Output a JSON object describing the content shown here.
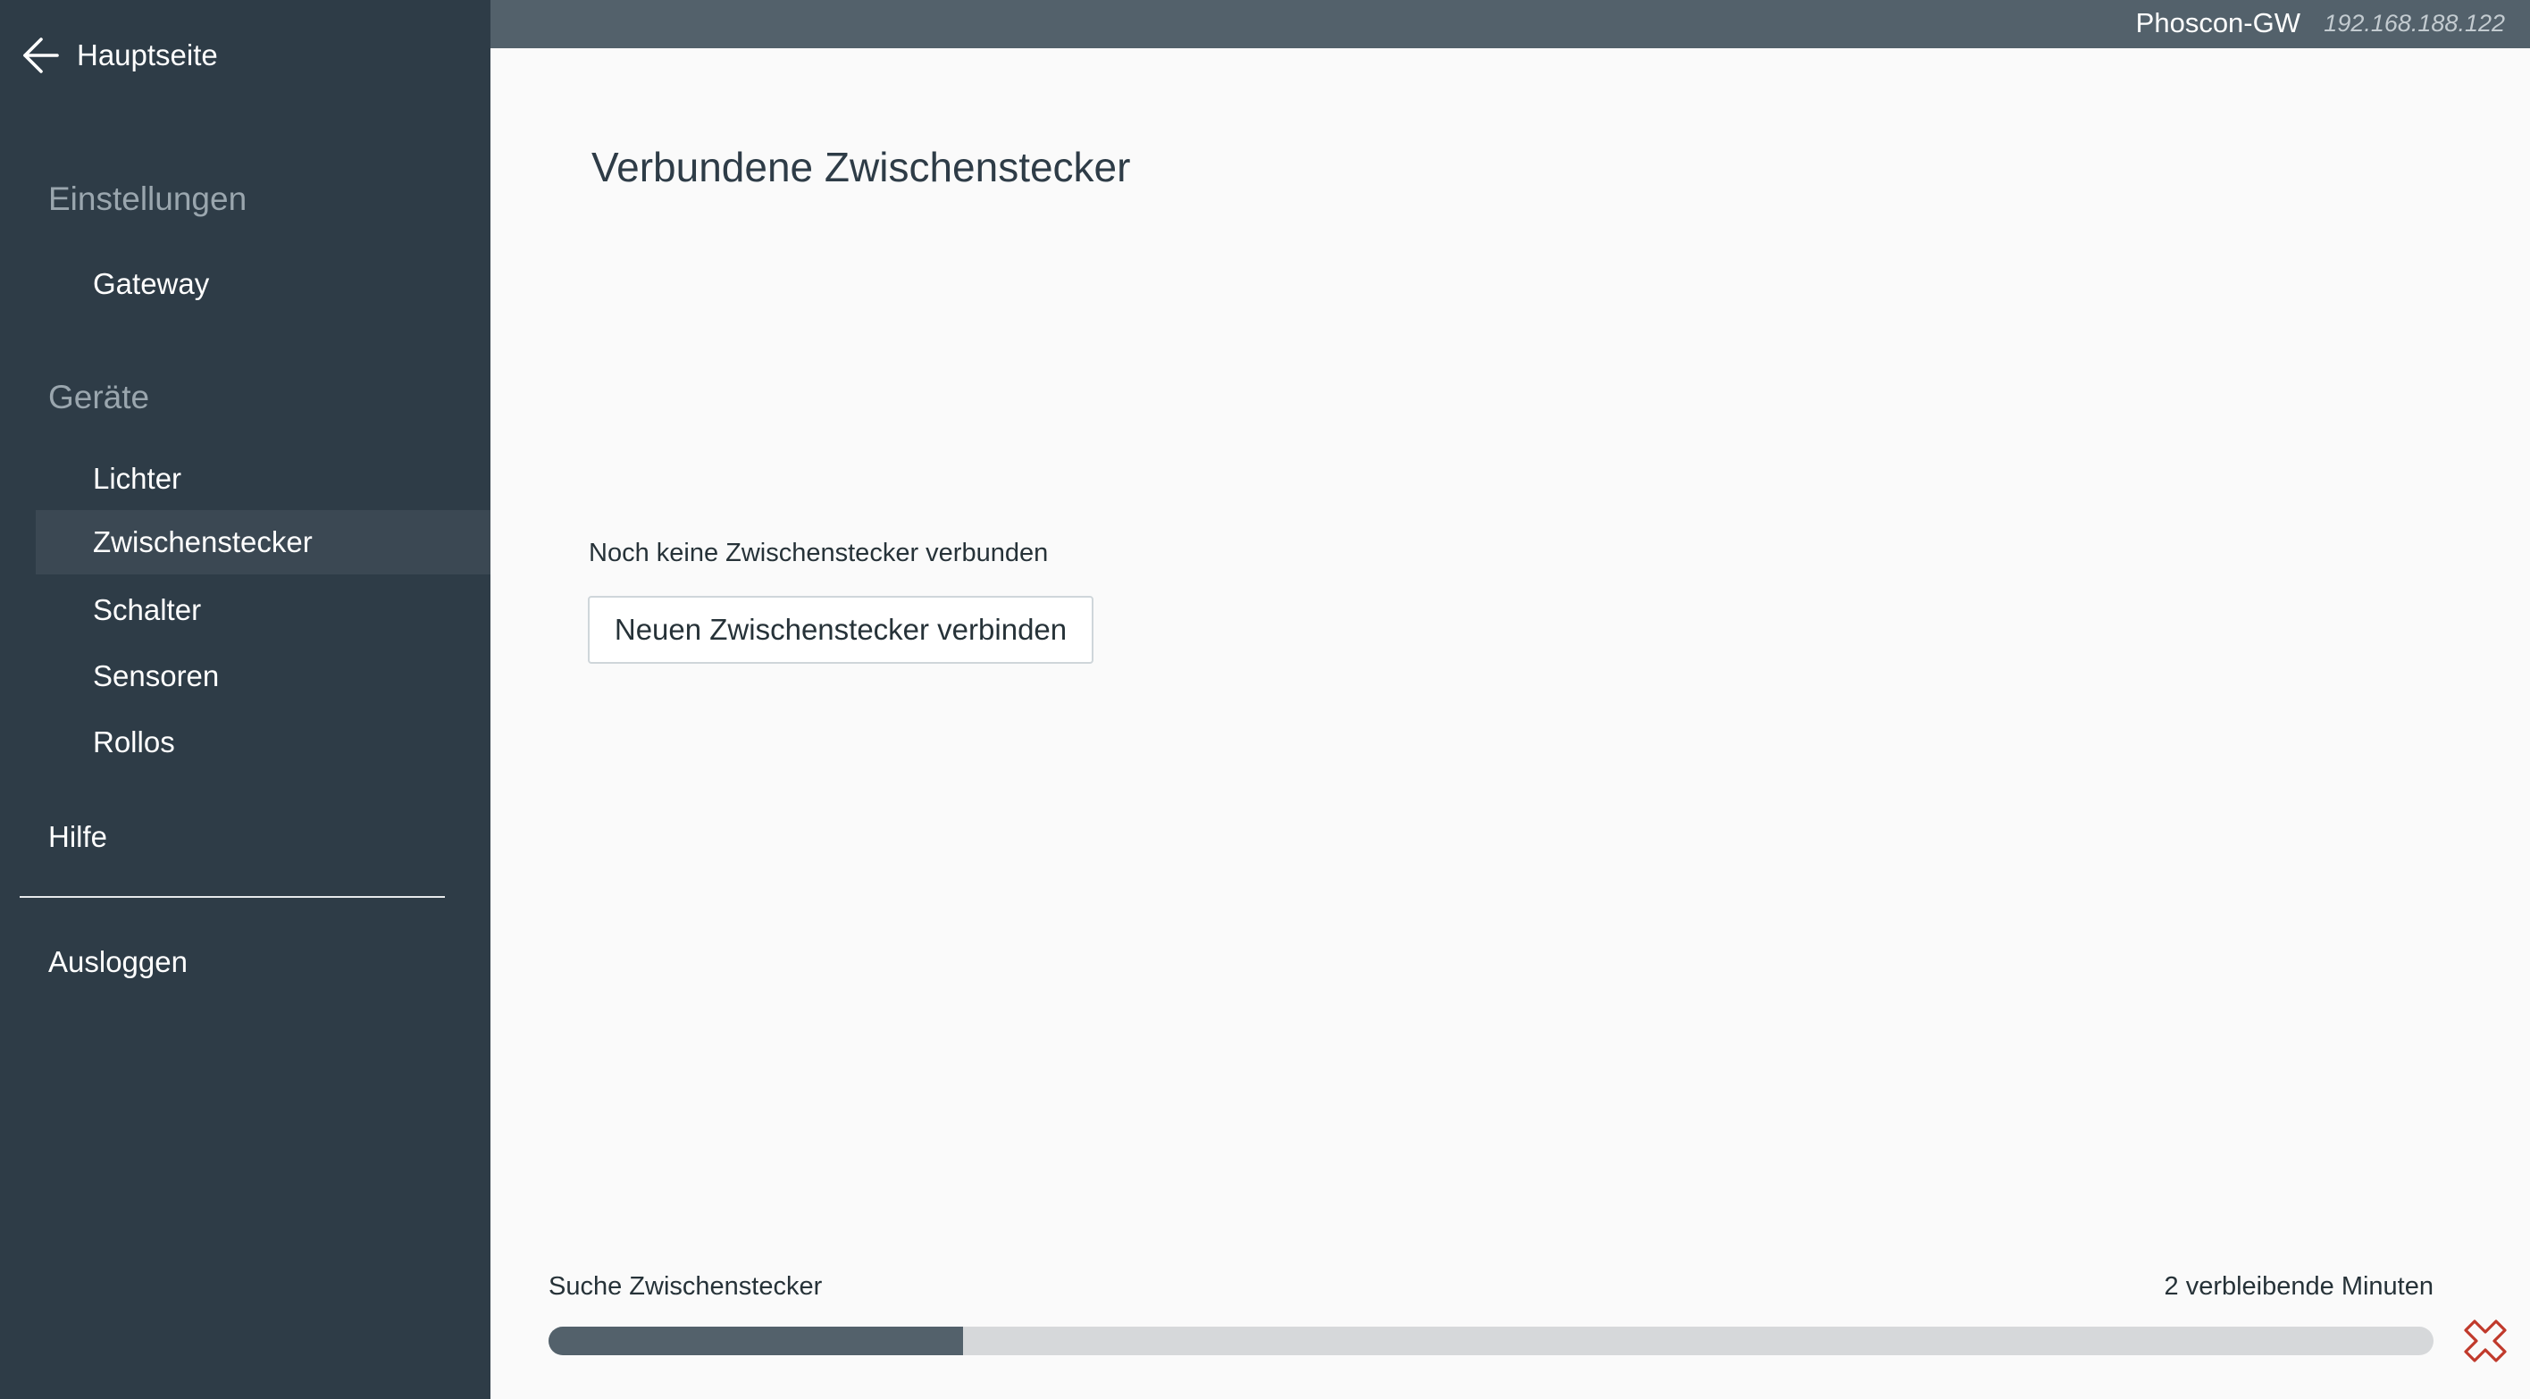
{
  "sidebar": {
    "back_label": "Hauptseite",
    "section_settings": "Einstellungen",
    "settings_items": [
      {
        "label": "Gateway"
      }
    ],
    "section_devices": "Geräte",
    "device_items": [
      {
        "label": "Lichter"
      },
      {
        "label": "Zwischenstecker",
        "active": true
      },
      {
        "label": "Schalter"
      },
      {
        "label": "Sensoren"
      },
      {
        "label": "Rollos"
      }
    ],
    "help_label": "Hilfe",
    "logout_label": "Ausloggen",
    "icons": {
      "back": "arrow-left-icon"
    }
  },
  "topbar": {
    "gateway_name": "Phoscon-GW",
    "gateway_ip": "192.168.188.122"
  },
  "main": {
    "title": "Verbundene Zwischenstecker",
    "empty_text": "Noch keine Zwischenstecker verbunden",
    "connect_button": "Neuen Zwischenstecker verbinden"
  },
  "search": {
    "label": "Suche Zwischenstecker",
    "remaining": "2 verbleibende Minuten",
    "progress_fraction": 0.22,
    "cancel_icon": "close-x-icon"
  },
  "colors": {
    "sidebar_bg": "#2e3c47",
    "active_item_bg": "#3b4853",
    "topbar_bg": "#53616b",
    "progress_fill": "#53616b",
    "progress_track": "#d6d8da",
    "cancel_accent": "#c0392b"
  }
}
